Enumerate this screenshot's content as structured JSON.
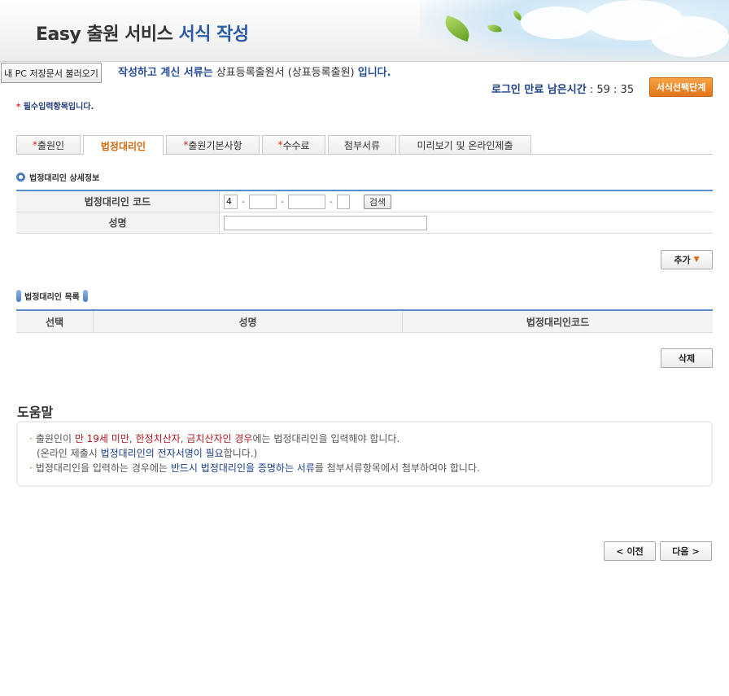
{
  "header": {
    "title_part1": "Easy 출원 서비스",
    "title_part2": "서식 작성"
  },
  "toolbar": {
    "load_button": "내 PC 저장문서 불러오기",
    "doc_prefix": "작성하고 계신 서류는",
    "doc_name": "상표등록출원서 (상표등록출원)",
    "doc_suffix": "입니다.",
    "timer_label": "로그인 만료 남은시간",
    "timer_value": ": 59 : 35",
    "form_select_button": "서식선택단계",
    "required_mark": "*",
    "required_note": "필수입력항목입니다."
  },
  "tabs": [
    {
      "mark": "*",
      "label": "출원인"
    },
    {
      "mark": "",
      "label": "법정대리인"
    },
    {
      "mark": "*",
      "label": "출원기본사항"
    },
    {
      "mark": "*",
      "label": "수수료"
    },
    {
      "mark": "",
      "label": "첨부서류"
    },
    {
      "mark": "",
      "label": "미리보기 및 온라인제출"
    }
  ],
  "detail": {
    "section_title": "법정대리인 상세정보",
    "code_label": "법정대리인 코드",
    "code_part1": "4",
    "code_dash": "-",
    "search_button": "검색",
    "name_label": "성명",
    "add_button": "추가"
  },
  "list": {
    "section_title": "법정대리인 목록",
    "columns": [
      "선택",
      "성명",
      "법정대리인코드"
    ],
    "delete_button": "삭제"
  },
  "help": {
    "title": "도움말",
    "bullet": "·",
    "l1_a": "출원인이 ",
    "l1_b": "만 19세 미만",
    "l1_c": ", ",
    "l1_d": "한정치산자",
    "l1_e": ", ",
    "l1_f": "금치산자인 경우",
    "l1_g": "에는 법정대리인을 입력해야 합니다.",
    "l2_a": "(온라인 제출시 ",
    "l2_b": "법정대리인의 전자서명이 필요",
    "l2_c": "합니다.)",
    "l3_a": "법정대리인을 입력하는 경우에는 ",
    "l3_b": "반드시 법정대리인을 증명하는 서류",
    "l3_c": "를 첨부서류항목에서 첨부하여야 합니다."
  },
  "nav": {
    "prev_arrow": "<",
    "prev": "이전",
    "next": "다음",
    "next_arrow": ">"
  },
  "colors": {
    "accent_blue": "#2a5aa8",
    "accent_orange": "#e2741a",
    "required_red": "#dd2222"
  }
}
